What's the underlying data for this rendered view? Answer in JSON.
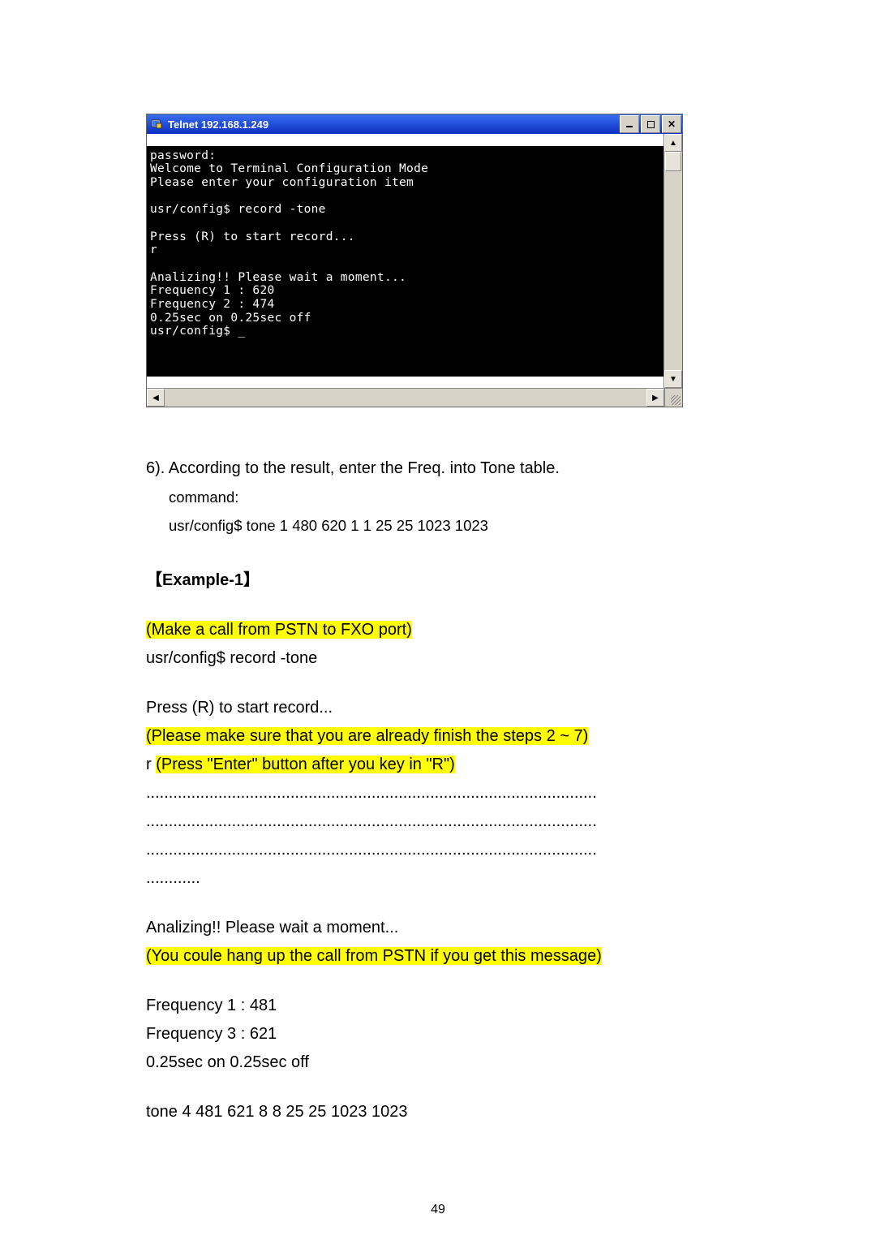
{
  "telnet": {
    "title": "Telnet 192.168.1.249",
    "lines": [
      "password:",
      "Welcome to Terminal Configuration Mode",
      "Please enter your configuration item",
      "",
      "usr/config$ record -tone",
      "",
      "Press (R) to start record...",
      "r",
      "",
      "Analizing!! Please wait a moment...",
      "Frequency 1 : 620",
      "Frequency 2 : 474",
      "0.25sec on 0.25sec off",
      "usr/config$ _"
    ]
  },
  "step6": {
    "text": "6). According to the result, enter the Freq. into Tone table.",
    "command_label": "command:",
    "command": "usr/config$ tone 1 480 620 1 1 25 25 1023 1023"
  },
  "example_heading": "【Example-1】",
  "example": {
    "make_call_hl": "(Make a call from PSTN to FXO port)",
    "line2": "usr/config$ record -tone",
    "line3": "Press (R) to start record...",
    "line4_hl": "(Please make sure that you are already finish the steps 2 ~ 7)",
    "line5_prefix": "r   ",
    "line5_hl": "(Press \"Enter\" button after you key in \"R\")",
    "dots1": "....................................................................................................",
    "dots2": "....................................................................................................",
    "dots3": "....................................................................................................",
    "dots4": "............",
    "analizing": "Analizing!! Please wait a moment...",
    "hangup_hl": "(You coule hang up the call from PSTN if you get this message)",
    "freq1": "Frequency 1 : 481",
    "freq3": "Frequency 3 : 621",
    "timing": "0.25sec on 0.25sec off",
    "tone_cmd": "tone 4 481 621 8 8 25 25 1023 1023"
  },
  "page_number": "49"
}
